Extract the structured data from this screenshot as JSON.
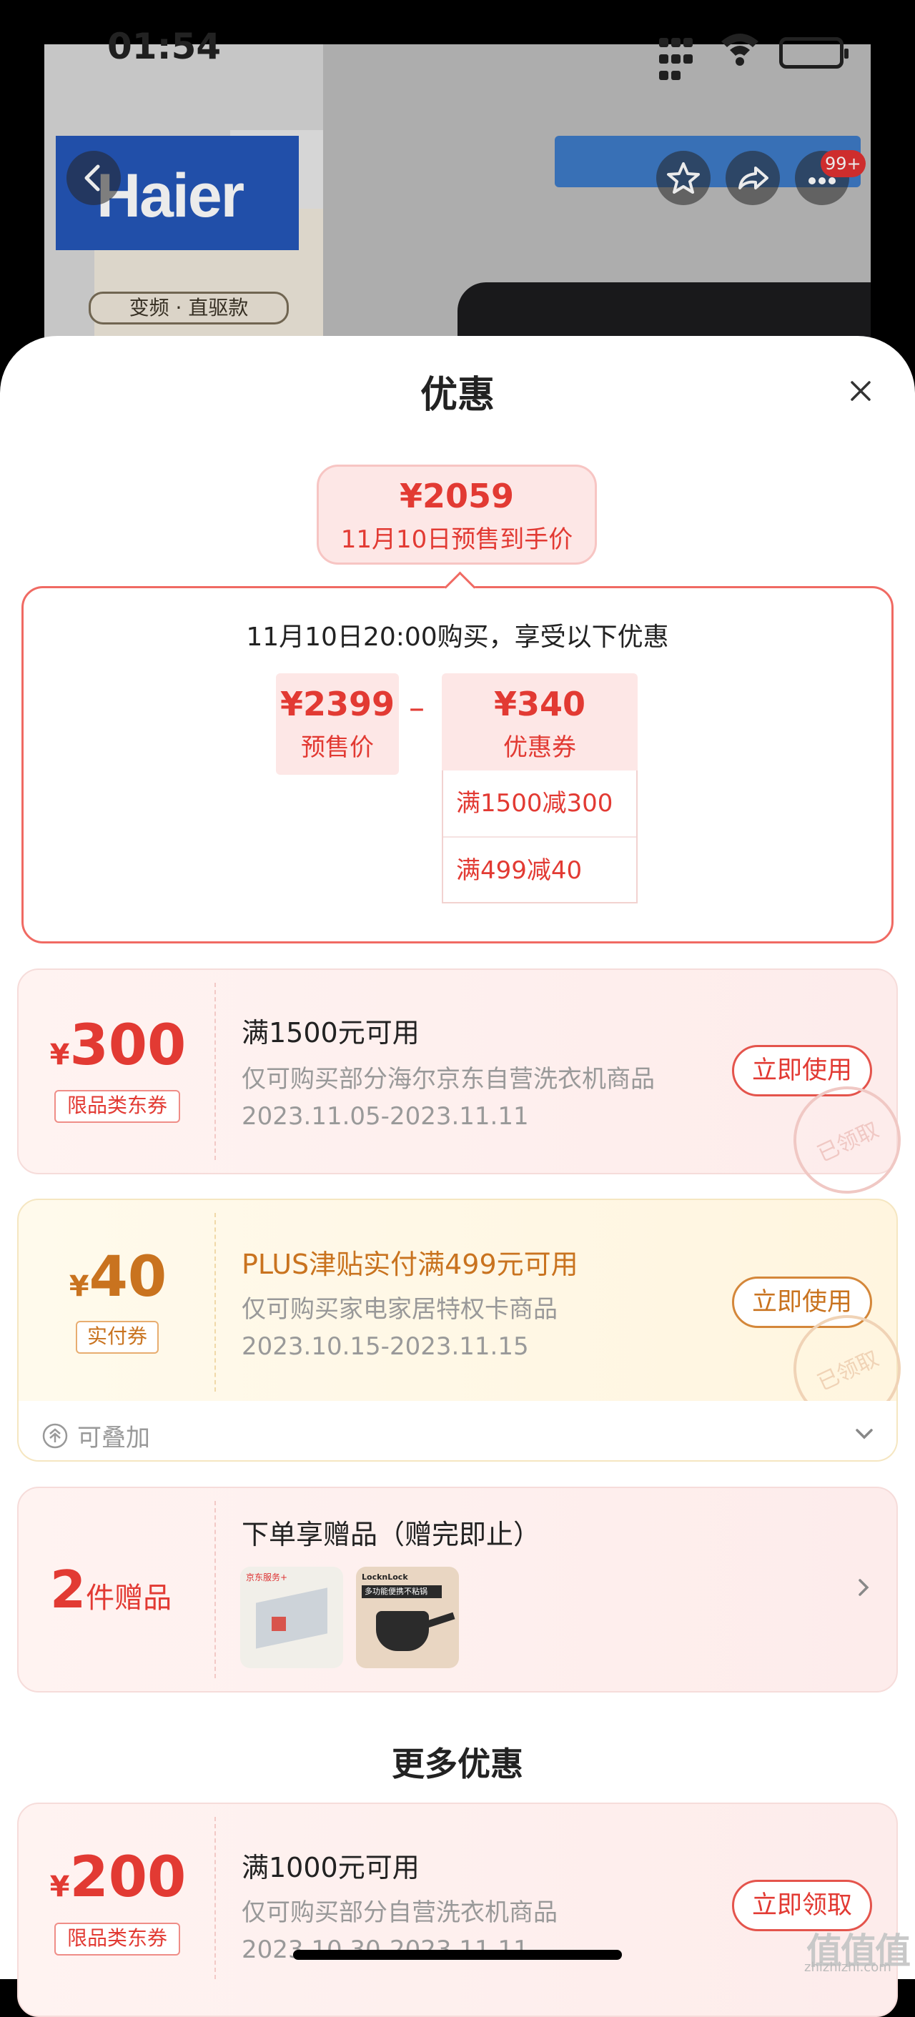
{
  "status": {
    "time": "01:54"
  },
  "background_page": {
    "brand": "Haier",
    "tag": "变频 · 直驱款",
    "badge_count": "99+"
  },
  "sheet": {
    "title": "优惠"
  },
  "estimate": {
    "price": "¥2059",
    "label": "11月10日预售到手价"
  },
  "breakdown": {
    "heading": "11月10日20:00购买，享受以下优惠",
    "presale": {
      "value": "¥2399",
      "label": "预售价"
    },
    "minus": "–",
    "coupon": {
      "value": "¥340",
      "label": "优惠券"
    },
    "coupon_items": [
      "满1500减300",
      "满499减40"
    ]
  },
  "coupons": [
    {
      "symbol": "¥",
      "amount": "300",
      "tag": "限品类东券",
      "title": "满1500元可用",
      "desc": "仅可购买部分海尔京东自营洗衣机商品",
      "dates": "2023.11.05-2023.11.11",
      "button": "立即使用",
      "stamp": "已领取"
    },
    {
      "symbol": "¥",
      "amount": "40",
      "tag": "实付券",
      "title": "PLUS津贴实付满499元可用",
      "desc": "仅可购买家电家居特权卡商品",
      "dates": "2023.10.15-2023.11.15",
      "button": "立即使用",
      "stamp": "已领取"
    }
  ],
  "stackable": {
    "label": "可叠加"
  },
  "gifts": {
    "count": "2",
    "unit": "件赠品",
    "title": "下单享赠品（赠完即止）",
    "gift1_caption": "京东服务+",
    "gift2_brand": "LocknLock",
    "gift2_caption": "多功能便携不粘锅"
  },
  "more": {
    "title": "更多优惠",
    "coupon": {
      "symbol": "¥",
      "amount": "200",
      "tag": "限品类东券",
      "title": "满1000元可用",
      "desc": "仅可购买部分自营洗衣机商品",
      "dates": "2023.10.30-2023.11.11",
      "button": "立即领取"
    }
  },
  "watermark": {
    "logo": "值值值",
    "url": "zhizhizhi.com"
  },
  "colors": {
    "accent": "#e23a33",
    "gold": "#c9731f"
  }
}
